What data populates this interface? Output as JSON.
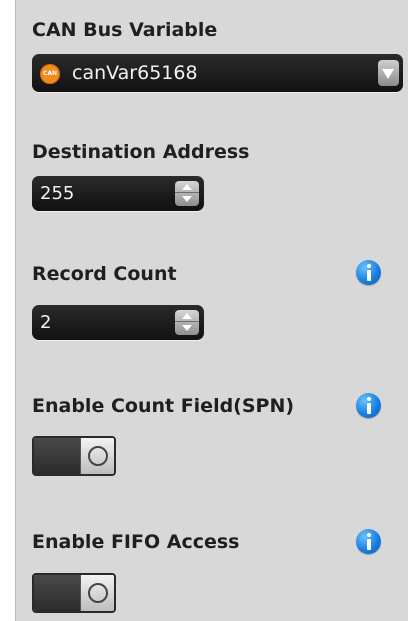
{
  "fields": {
    "can_bus_variable": {
      "label": "CAN Bus Variable",
      "icon_text": "CAN",
      "icon": "can-badge-icon",
      "value": "canVar65168"
    },
    "destination_address": {
      "label": "Destination Address",
      "value": "255"
    },
    "record_count": {
      "label": "Record Count",
      "value": "2"
    },
    "enable_count_field": {
      "label": "Enable Count Field(SPN)",
      "state": "off"
    },
    "enable_fifo_access": {
      "label": "Enable FIFO Access",
      "state": "off"
    }
  },
  "colors": {
    "panel_bg": "#d8d8d8",
    "info_blue": "#1a7fe0",
    "can_orange": "#f08c1a",
    "control_dark": "#1a1a1a"
  }
}
